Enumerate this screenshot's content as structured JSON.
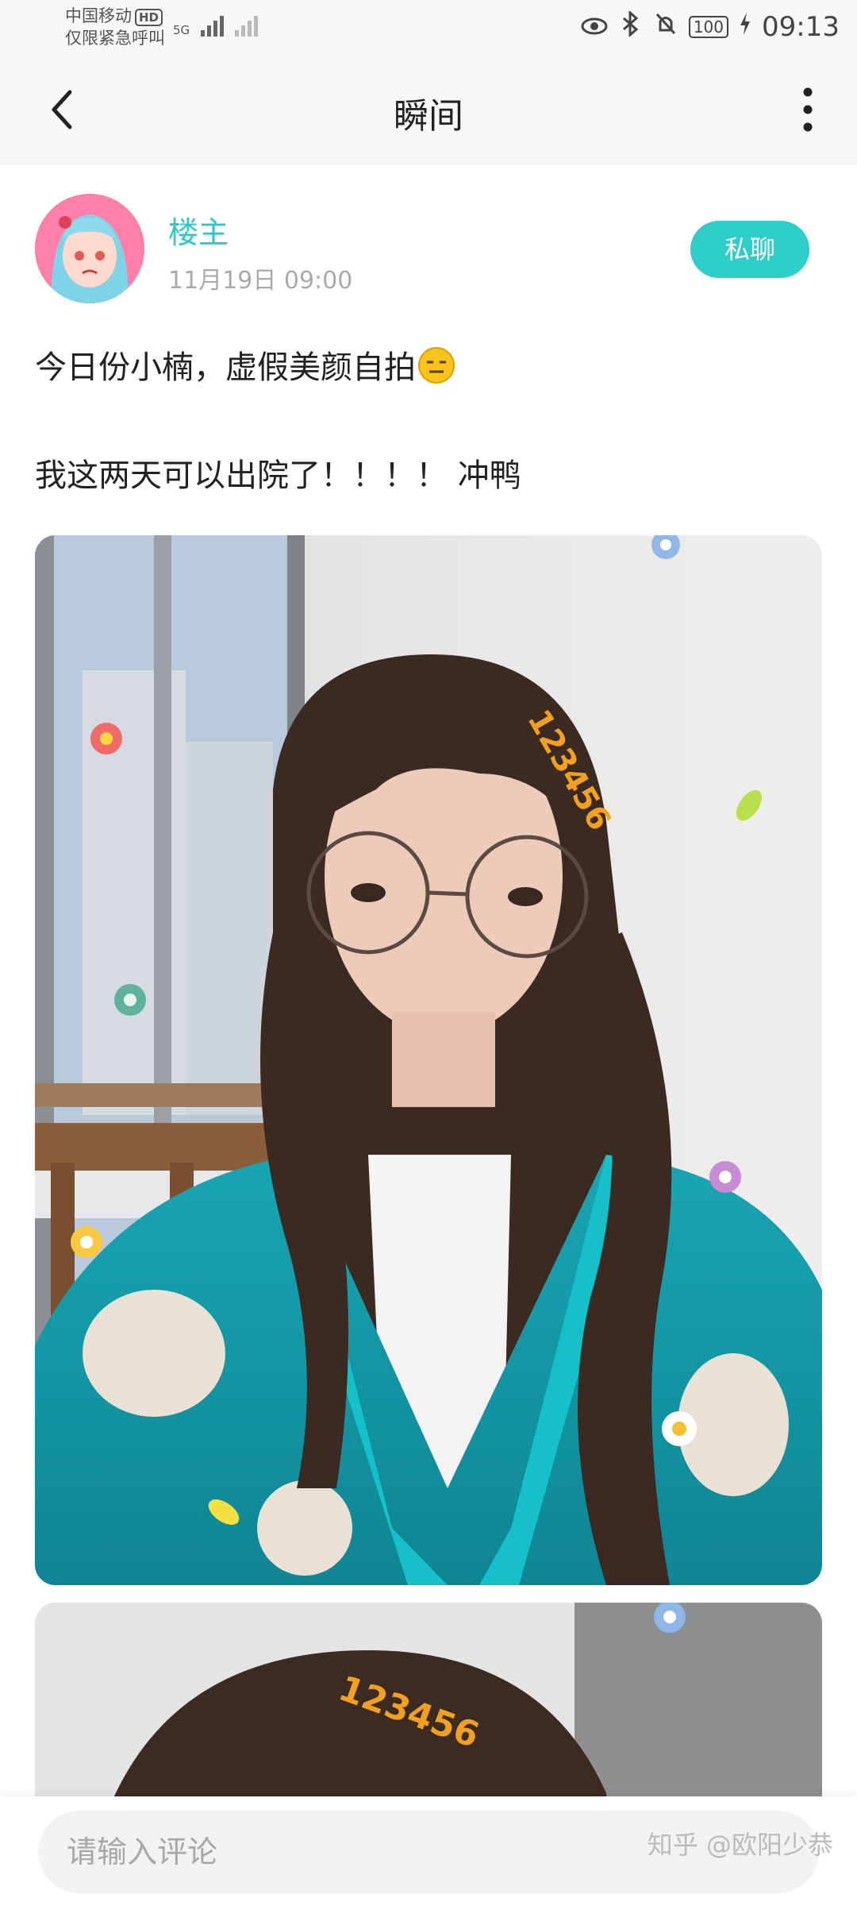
{
  "status_bar": {
    "carrier": "中国移动",
    "hd": "HD",
    "emergency": "仅限紧急呼叫",
    "network": "5G",
    "battery": "100",
    "time": "09:13"
  },
  "header": {
    "title": "瞬间"
  },
  "post": {
    "author": "楼主",
    "date": "11月19日 09:00",
    "chat_button": "私聊",
    "line1": "今日份小楠，虚假美颜自拍",
    "line2": "我这两天可以出院了！！！！ 冲鸭"
  },
  "photo_sticker": "123456",
  "comment": {
    "placeholder": "请输入评论"
  },
  "watermark": "知乎 @欧阳少恭",
  "colors": {
    "accent": "#2dcdc9",
    "author": "#2bc8c8",
    "topbar": "#f7f7f7"
  },
  "icons": [
    "back-icon",
    "more-icon",
    "eye-icon",
    "bluetooth-icon",
    "mute-icon",
    "charging-icon"
  ]
}
